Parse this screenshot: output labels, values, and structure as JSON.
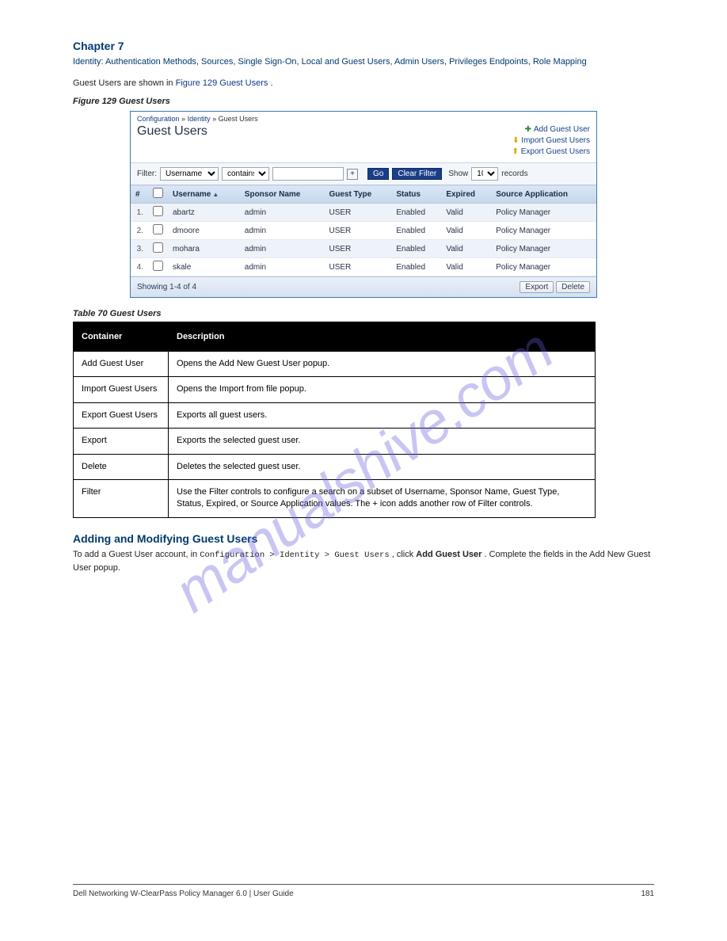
{
  "header": {
    "section_caption": "Chapter 7",
    "section_title": "Identity: Authentication Methods, Sources, Single Sign-On, Local and Guest Users, Admin Users, Privileges Endpoints, Role Mapping",
    "intro_before": "Guest Users are shown in ",
    "intro_after": "."
  },
  "figure": {
    "caption": "Figure 129 Guest Users"
  },
  "screenshot": {
    "breadcrumb": [
      "Configuration",
      "Identity",
      "Guest Users"
    ],
    "title": "Guest Users",
    "quicklinks": {
      "add": "Add Guest User",
      "import": "Import Guest Users",
      "export": "Export Guest Users"
    },
    "filter": {
      "label": "Filter:",
      "column": "Username",
      "operator": "contains",
      "value": "",
      "go": "Go",
      "clear": "Clear Filter",
      "show_prefix": "Show",
      "show_value": "10",
      "show_suffix": "records"
    },
    "columns": [
      "#",
      "",
      "Username",
      "Sponsor Name",
      "Guest Type",
      "Status",
      "Expired",
      "Source Application"
    ],
    "sort_column": "Username",
    "sort_dir": "asc",
    "rows": [
      {
        "idx": "1.",
        "username": "abartz",
        "sponsor": "admin",
        "gtype": "USER",
        "status": "Enabled",
        "expired": "Valid",
        "src": "Policy Manager"
      },
      {
        "idx": "2.",
        "username": "dmoore",
        "sponsor": "admin",
        "gtype": "USER",
        "status": "Enabled",
        "expired": "Valid",
        "src": "Policy Manager"
      },
      {
        "idx": "3.",
        "username": "mohara",
        "sponsor": "admin",
        "gtype": "USER",
        "status": "Enabled",
        "expired": "Valid",
        "src": "Policy Manager"
      },
      {
        "idx": "4.",
        "username": "skale",
        "sponsor": "admin",
        "gtype": "USER",
        "status": "Enabled",
        "expired": "Valid",
        "src": "Policy Manager"
      }
    ],
    "footer": {
      "showing": "Showing 1-4 of 4",
      "export": "Export",
      "delete": "Delete"
    }
  },
  "table": {
    "title": "Table 70 Guest Users",
    "head": [
      "Container",
      "Description"
    ],
    "rows": [
      {
        "c": "Add Guest User",
        "d": "Opens the Add New Guest User popup."
      },
      {
        "c": "Import Guest Users",
        "d": "Opens the Import from file popup."
      },
      {
        "c": "Export Guest Users",
        "d": "Exports all guest users."
      },
      {
        "c": "Export",
        "d": "Exports the selected guest user."
      },
      {
        "c": "Delete",
        "d": "Deletes the selected guest user."
      },
      {
        "c": "Filter",
        "d": "Use the Filter controls to configure a search on a subset of Username, Sponsor Name, Guest Type, Status, Expired, or Source Application values. The + icon adds another row of Filter controls."
      }
    ]
  },
  "addon_heading": "Adding and Modifying Guest Users",
  "addon_para_before": "To add a Guest User account, in ",
  "addon_path": "Configuration > Identity > Guest Users",
  "addon_para_mid": ", click ",
  "addon_action": "Add Guest User",
  "addon_para_end": ". Complete the fields in the Add New Guest User popup.",
  "watermark": "manualshive.com",
  "footer": {
    "left": "Dell Networking W-ClearPass Policy Manager 6.0 | User Guide",
    "right": "181"
  }
}
